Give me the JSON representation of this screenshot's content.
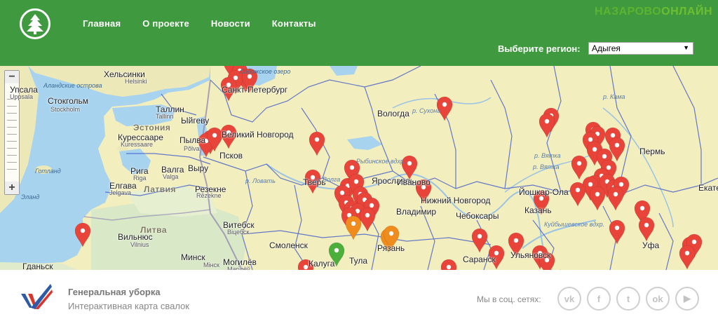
{
  "header": {
    "nav": [
      "Главная",
      "О проекте",
      "Новости",
      "Контакты"
    ],
    "brand_part1": "НАЗАРОВО",
    "brand_part2": "ОНЛАЙН",
    "region_label": "Выберите регион:",
    "region_value": "Адыгея"
  },
  "map": {
    "labels": [
      {
        "text": "Хельсинки",
        "cls": ""
      },
      {
        "text": "Helsinki",
        "cls": "small"
      },
      {
        "text": "Аландские острова",
        "cls": "sea"
      },
      {
        "text": "Упсала",
        "cls": ""
      },
      {
        "text": "Uppsala",
        "cls": "small"
      },
      {
        "text": "Стокгольм",
        "cls": ""
      },
      {
        "text": "Stockholm",
        "cls": "small"
      },
      {
        "text": "Таллин",
        "cls": ""
      },
      {
        "text": "Tallinn",
        "cls": "small"
      },
      {
        "text": "Эстония",
        "cls": "country"
      },
      {
        "text": "Курессааре",
        "cls": ""
      },
      {
        "text": "Kuressaare",
        "cls": "small"
      },
      {
        "text": "Ыйгеву",
        "cls": ""
      },
      {
        "text": "Пылва",
        "cls": ""
      },
      {
        "text": "Põlva",
        "cls": "small"
      },
      {
        "text": "Выру",
        "cls": ""
      },
      {
        "text": "Готланд",
        "cls": "sea"
      },
      {
        "text": "Рига",
        "cls": ""
      },
      {
        "text": "Riga",
        "cls": "small"
      },
      {
        "text": "Валга",
        "cls": ""
      },
      {
        "text": "Valga",
        "cls": "small"
      },
      {
        "text": "Елгава",
        "cls": ""
      },
      {
        "text": "Jelgava",
        "cls": "small"
      },
      {
        "text": "Латвия",
        "cls": "country"
      },
      {
        "text": "Резекне",
        "cls": ""
      },
      {
        "text": "Rēzekne",
        "cls": "small"
      },
      {
        "text": "Эланд",
        "cls": "sea"
      },
      {
        "text": "Литва",
        "cls": "country"
      },
      {
        "text": "Вильнюс",
        "cls": ""
      },
      {
        "text": "Vilnius",
        "cls": "small"
      },
      {
        "text": "Гданьск",
        "cls": ""
      },
      {
        "text": "Минск",
        "cls": ""
      },
      {
        "text": "Мінск",
        "cls": "small"
      },
      {
        "text": "Витебск",
        "cls": ""
      },
      {
        "text": "Віцебск",
        "cls": "small"
      },
      {
        "text": "Могилёв",
        "cls": ""
      },
      {
        "text": "Магілёў",
        "cls": "small"
      },
      {
        "text": "Смоленск",
        "cls": ""
      },
      {
        "text": "Великий Новгород",
        "cls": ""
      },
      {
        "text": "Псков",
        "cls": ""
      },
      {
        "text": "Санкт-Петербург",
        "cls": ""
      },
      {
        "text": "Ладожское озеро",
        "cls": "sea"
      },
      {
        "text": "Вологда",
        "cls": ""
      },
      {
        "text": "Рыбинское вдхр.",
        "cls": "river"
      },
      {
        "text": "р. Сухона",
        "cls": "river"
      },
      {
        "text": "Ярославль",
        "cls": ""
      },
      {
        "text": "Иваново",
        "cls": ""
      },
      {
        "text": "Тверь",
        "cls": ""
      },
      {
        "text": "Владимир",
        "cls": ""
      },
      {
        "text": "Нижний Новгород",
        "cls": ""
      },
      {
        "text": "Чебоксары",
        "cls": ""
      },
      {
        "text": "Йошкар-Ола",
        "cls": ""
      },
      {
        "text": "Казань",
        "cls": ""
      },
      {
        "text": "Пермь",
        "cls": ""
      },
      {
        "text": "Екатеринбург",
        "cls": ""
      },
      {
        "text": "Рязань",
        "cls": ""
      },
      {
        "text": "Калуга",
        "cls": ""
      },
      {
        "text": "Тула",
        "cls": ""
      },
      {
        "text": "Саранск",
        "cls": ""
      },
      {
        "text": "Ульяновск",
        "cls": ""
      },
      {
        "text": "Уфа",
        "cls": ""
      },
      {
        "text": "р. Вятка",
        "cls": "river"
      },
      {
        "text": "р. Кама",
        "cls": "river"
      },
      {
        "text": "Куйбышевское вдхр.",
        "cls": "river"
      },
      {
        "text": "р. Волга",
        "cls": "river"
      },
      {
        "text": "р. Ловать",
        "cls": "river"
      },
      {
        "text": "р. Вятка",
        "cls": "river"
      }
    ],
    "pins_red": 62,
    "pins_orange": 3,
    "pins_green": 1,
    "colors": {
      "red": "#e8443a",
      "orange": "#f08c1e",
      "green": "#4caf3c",
      "water": "#a8d3ef",
      "land": "#f3eebd",
      "border": "#4b63c9"
    }
  },
  "footer": {
    "title": "Генеральная уборка",
    "subtitle": "Интерактивная карта свалок",
    "social_label": "Мы в соц. сетях:",
    "social": [
      {
        "name": "vk",
        "glyph": "vk"
      },
      {
        "name": "facebook",
        "glyph": "f"
      },
      {
        "name": "twitter",
        "glyph": "t"
      },
      {
        "name": "odnoklassniki",
        "glyph": "ok"
      },
      {
        "name": "youtube",
        "glyph": "▶"
      }
    ]
  }
}
